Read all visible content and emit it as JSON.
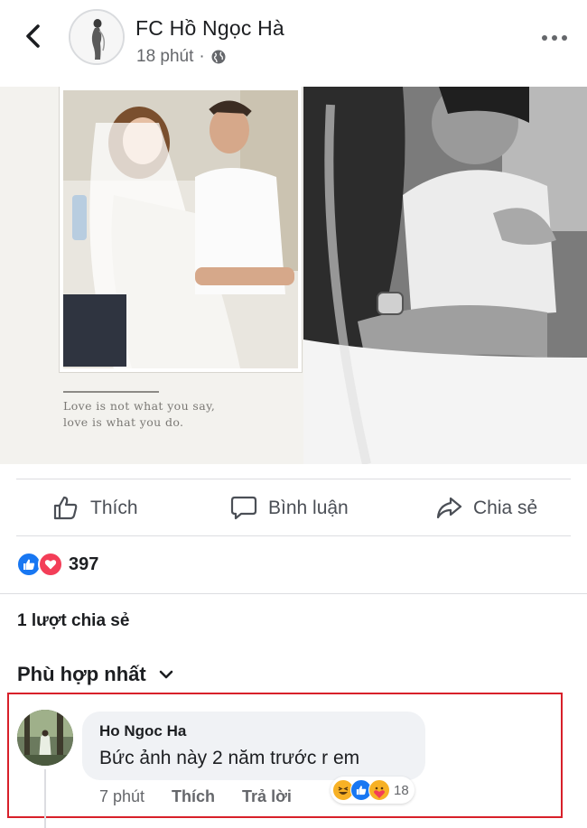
{
  "post": {
    "page_name": "FC Hồ Ngọc Hà",
    "time": "18 phút",
    "separator": "·",
    "quote_lines": [
      "Love is not what you say,",
      "love is what you do."
    ]
  },
  "actions": {
    "like_label": "Thích",
    "comment_label": "Bình luận",
    "share_label": "Chia sẻ"
  },
  "reactions": {
    "icons": [
      "like-icon",
      "love-icon"
    ],
    "count": "397"
  },
  "shares_text": "1 lượt chia sẻ",
  "filter_label": "Phù hợp nhất",
  "comment": {
    "author": "Ho Ngoc Ha",
    "text": "Bức ảnh này 2 năm trước r em",
    "time": "7 phút",
    "like_label": "Thích",
    "reply_label": "Trả lời",
    "reaction_icons": [
      "haha-icon",
      "like-icon",
      "care-icon"
    ],
    "reaction_count": "18"
  },
  "colors": {
    "like_blue": "#1877f2",
    "love_red": "#f33e58",
    "haha_yellow": "#f7b125",
    "highlight_red": "#d8202a"
  }
}
